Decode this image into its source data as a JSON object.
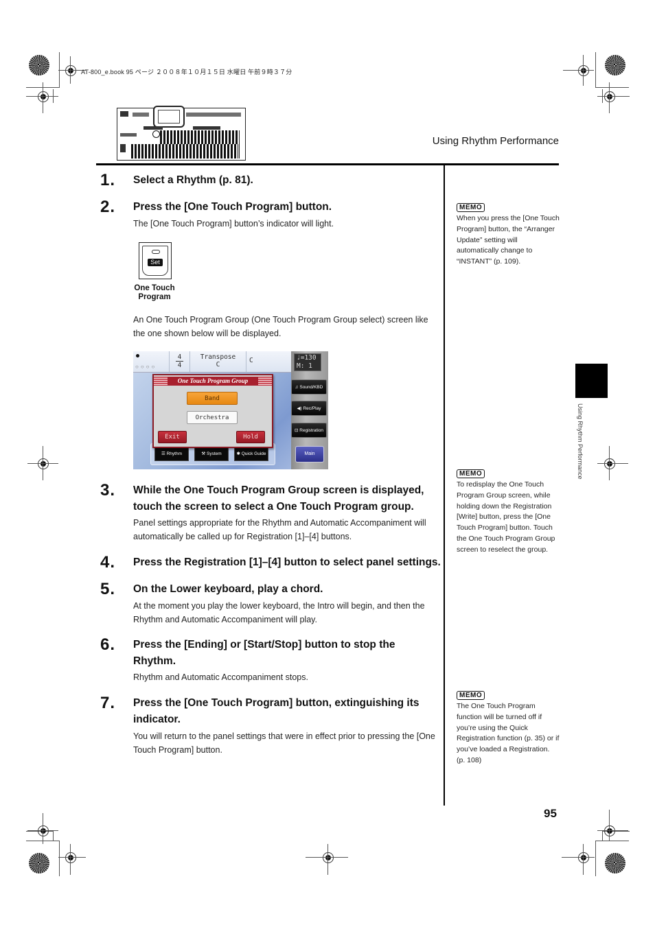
{
  "print_header": "AT-800_e.book  95 ページ  ２００８年１０月１５日  水曜日  午前９時３７分",
  "header": {
    "section_title": "Using Rhythm Performance"
  },
  "steps": [
    {
      "num": "1.",
      "title": "Select a Rhythm (p. 81)."
    },
    {
      "num": "2.",
      "title": "Press the [One Touch Program] button.",
      "body": "The [One Touch Program] button’s indicator will light."
    },
    {
      "num": "3.",
      "title": "While the One Touch Program Group screen is displayed, touch the screen to select a One Touch Program group.",
      "body": "Panel settings appropriate for the Rhythm and Automatic Accompaniment will automatically be called up for Registration [1]–[4] buttons."
    },
    {
      "num": "4.",
      "title": "Press the Registration [1]–[4] button to select panel settings."
    },
    {
      "num": "5.",
      "title": "On the Lower keyboard, play a chord.",
      "body": "At the moment you play the lower keyboard, the Intro will begin, and then the Rhythm and Automatic Accompaniment will play."
    },
    {
      "num": "6.",
      "title": "Press the [Ending] or [Start/Stop] button to stop the Rhythm.",
      "body": "Rhythm and Automatic Accompaniment stops."
    },
    {
      "num": "7.",
      "title": "Press the [One Touch Program] button, extinguishing its indicator.",
      "body": "You will return to the panel settings that were in effect prior to pressing the [One Touch Program] button."
    }
  ],
  "intro_text": "An One Touch Program Group (One Touch Program Group select) screen like the one shown below will be displayed.",
  "otp_button": {
    "key_label": "Set",
    "caption_line1": "One Touch",
    "caption_line2": "Program"
  },
  "lcd": {
    "time_sig_top": "4",
    "time_sig_bottom": "4",
    "transpose_label": "Transpose",
    "transpose_value": "C",
    "chord": "C",
    "tempo": "♩=130",
    "measure": "M:  1",
    "dialog_title": "One Touch Program Group",
    "groups": [
      "Band",
      "Orchestra"
    ],
    "selected_group": "Band",
    "exit_label": "Exit",
    "hold_label": "Hold",
    "side_buttons": [
      "Sound/KBD",
      "Rec/Play",
      "Registration"
    ],
    "main_label": "Main",
    "bottom_buttons": [
      "Rhythm",
      "System",
      "Quick Guide"
    ]
  },
  "memos": [
    {
      "badge": "MEMO",
      "text": "When you press the [One Touch Program] button, the “Arranger Update” setting will automatically change to “INSTANT” (p. 109)."
    },
    {
      "badge": "MEMO",
      "text": "To redisplay the One Touch Program Group screen, while holding down the Registration [Write] button, press the [One Touch Program] button. Touch the One Touch Program Group screen to reselect the group."
    },
    {
      "badge": "MEMO",
      "text": "The One Touch Program function will be turned off if you’re using the Quick Registration function (p. 35) or if you’ve loaded a Registration. (p. 108)"
    }
  ],
  "side_tab_label": "Using Rhythm Performance",
  "page_number": "95"
}
